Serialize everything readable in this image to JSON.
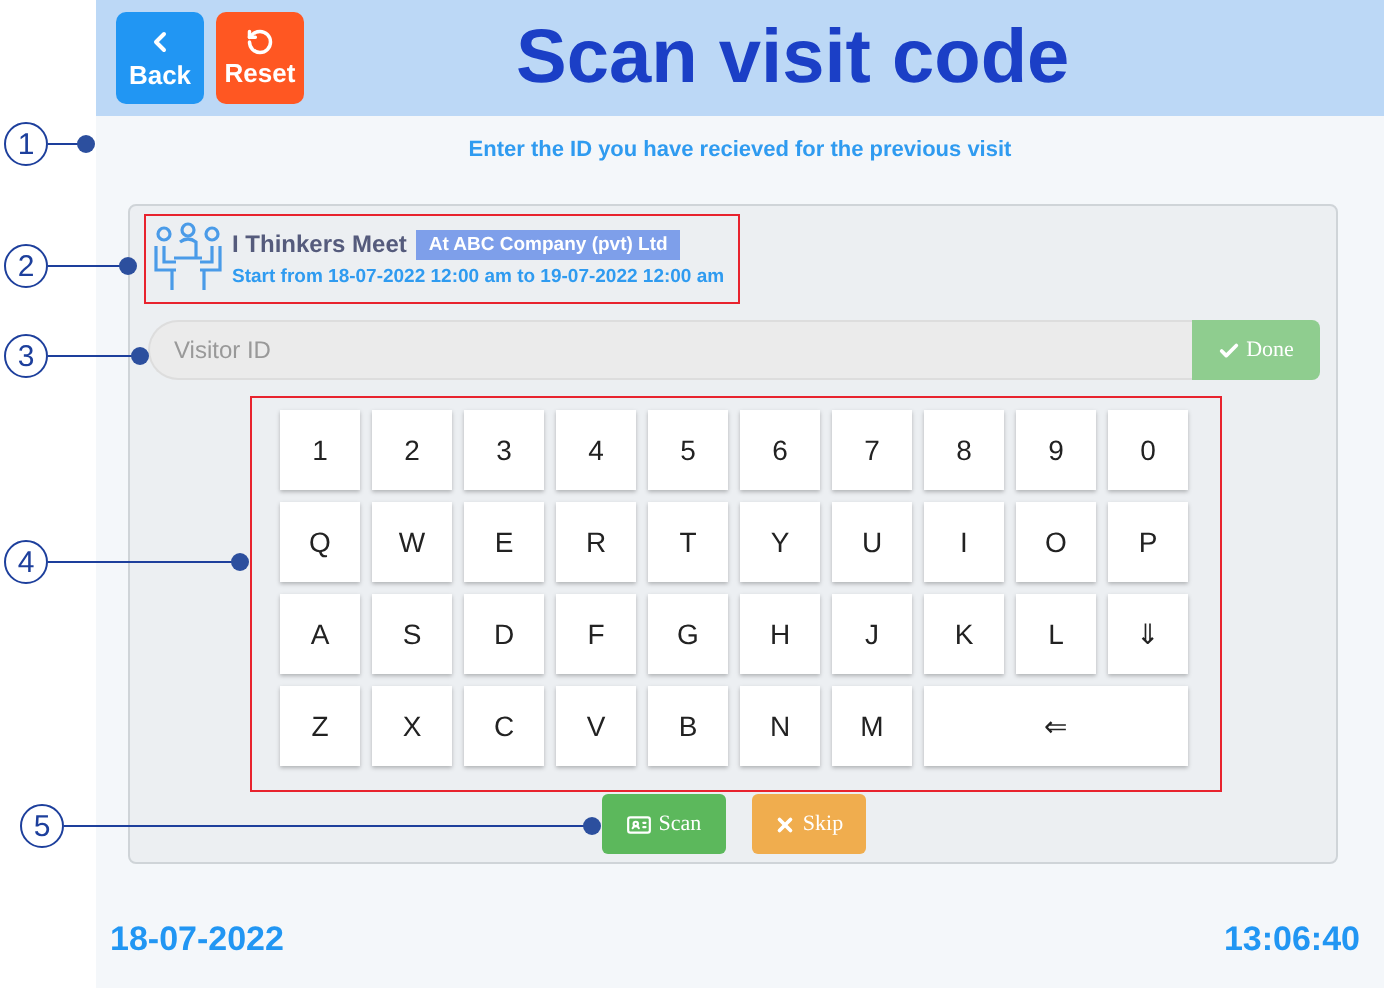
{
  "header": {
    "title": "Scan visit code",
    "buttons": [
      {
        "kind": "back",
        "label": "Back"
      },
      {
        "kind": "reset",
        "label": "Reset"
      }
    ]
  },
  "instruction": "Enter the ID you have recieved for the previous visit",
  "event": {
    "name": "I Thinkers Meet",
    "venue": "At ABC Company (pvt) Ltd",
    "schedule": "Start from 18-07-2022 12:00 am to 19-07-2022 12:00 am"
  },
  "visitor_field": {
    "placeholder": "Visitor ID",
    "button": "Done"
  },
  "keyboard": [
    [
      {
        "label": "1",
        "kind": "key"
      },
      {
        "label": "2",
        "kind": "key"
      },
      {
        "label": "3",
        "kind": "key"
      },
      {
        "label": "4",
        "kind": "key"
      },
      {
        "label": "5",
        "kind": "key"
      },
      {
        "label": "6",
        "kind": "key"
      },
      {
        "label": "7",
        "kind": "key"
      },
      {
        "label": "8",
        "kind": "key"
      },
      {
        "label": "9",
        "kind": "key"
      },
      {
        "label": "0",
        "kind": "key"
      }
    ],
    [
      {
        "label": "Q",
        "kind": "key"
      },
      {
        "label": "W",
        "kind": "key"
      },
      {
        "label": "E",
        "kind": "key"
      },
      {
        "label": "R",
        "kind": "key"
      },
      {
        "label": "T",
        "kind": "key"
      },
      {
        "label": "Y",
        "kind": "key"
      },
      {
        "label": "U",
        "kind": "key"
      },
      {
        "label": "I",
        "kind": "key"
      },
      {
        "label": "O",
        "kind": "key"
      },
      {
        "label": "P",
        "kind": "key"
      }
    ],
    [
      {
        "label": "A",
        "kind": "key"
      },
      {
        "label": "S",
        "kind": "key"
      },
      {
        "label": "D",
        "kind": "key"
      },
      {
        "label": "F",
        "kind": "key"
      },
      {
        "label": "G",
        "kind": "key"
      },
      {
        "label": "H",
        "kind": "key"
      },
      {
        "label": "J",
        "kind": "key"
      },
      {
        "label": "K",
        "kind": "key"
      },
      {
        "label": "L",
        "kind": "key"
      },
      {
        "label": "⇓",
        "kind": "key"
      }
    ],
    [
      {
        "label": "Z",
        "kind": "key"
      },
      {
        "label": "X",
        "kind": "key"
      },
      {
        "label": "C",
        "kind": "key"
      },
      {
        "label": "V",
        "kind": "key"
      },
      {
        "label": "B",
        "kind": "key"
      },
      {
        "label": "N",
        "kind": "key"
      },
      {
        "label": "M",
        "kind": "key"
      },
      {
        "label": "⇐",
        "kind": "wide"
      }
    ]
  ],
  "actions": [
    {
      "kind": "scan",
      "label": "Scan"
    },
    {
      "kind": "skip",
      "label": "Skip"
    }
  ],
  "footer": {
    "date": "18-07-2022",
    "time": "13:06:40"
  },
  "annotations": [
    {
      "label": "1"
    },
    {
      "label": "2"
    },
    {
      "label": "3"
    },
    {
      "label": "4"
    },
    {
      "label": "5"
    }
  ]
}
